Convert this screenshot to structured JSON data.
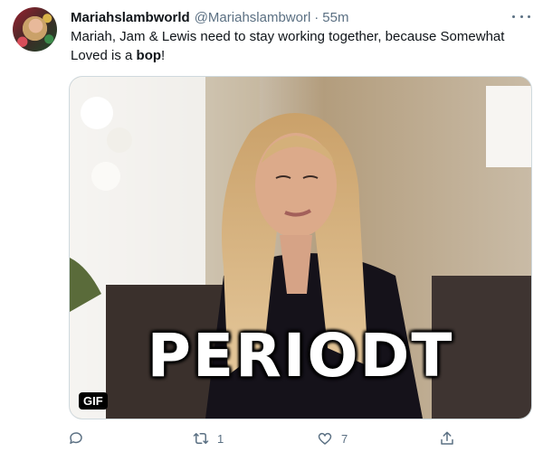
{
  "tweet": {
    "display_name": "Mariahslambworld",
    "handle": "@Mariahslambworl",
    "separator": "·",
    "time": "55m",
    "text_before": "Mariah, Jam & Lewis need to stay working together, because Somewhat Loved is a ",
    "text_bold": "bop",
    "text_after": "!"
  },
  "media": {
    "caption": "PERIODT",
    "badge": "GIF"
  },
  "actions": {
    "reply_count": "",
    "retweet_count": "1",
    "like_count": "7"
  },
  "icons": [
    "more-icon",
    "reply-icon",
    "retweet-icon",
    "like-icon",
    "share-icon"
  ],
  "colors": {
    "secondary_text": "#5b7083",
    "primary_text": "#0f1419"
  }
}
